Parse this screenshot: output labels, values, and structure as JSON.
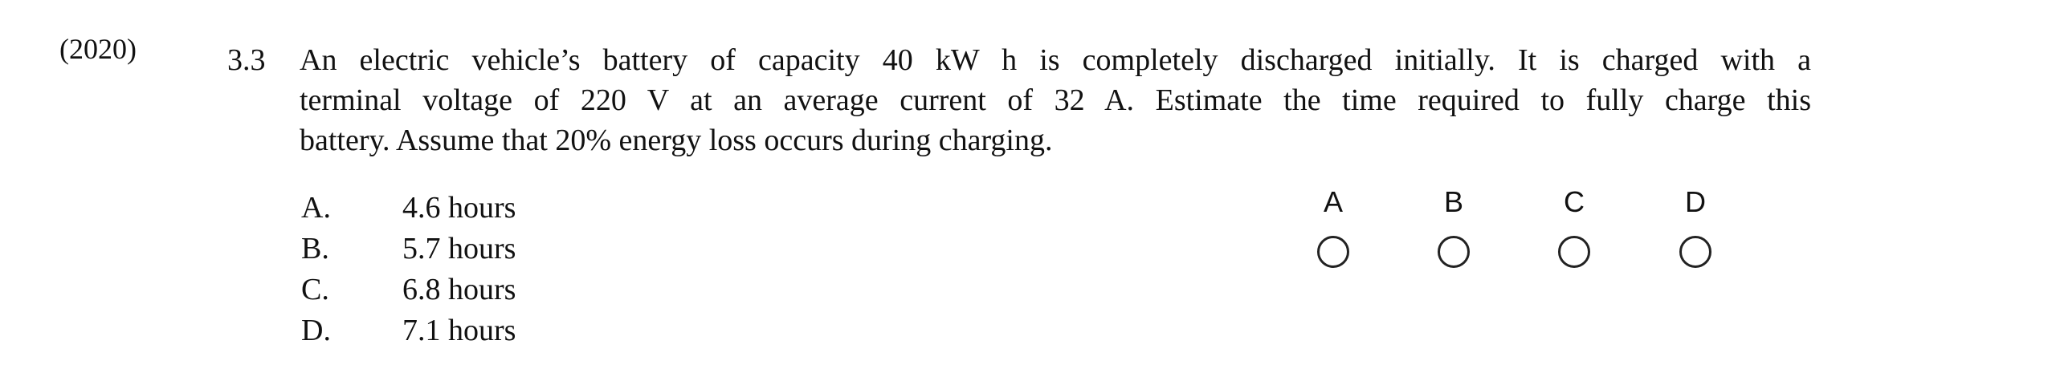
{
  "year": "(2020)",
  "question": {
    "number": "3.3",
    "lines": [
      "An electric vehicle’s battery of capacity 40 kW h is completely discharged initially.  It is charged with a",
      "terminal voltage of 220 V at an average current of 32 A.  Estimate the time required to fully charge this",
      "battery.  Assume that 20% energy loss occurs during charging."
    ]
  },
  "choices": [
    {
      "letter": "A.",
      "text": "4.6 hours"
    },
    {
      "letter": "B.",
      "text": "5.7 hours"
    },
    {
      "letter": "C.",
      "text": "6.8 hours"
    },
    {
      "letter": "D.",
      "text": "7.1 hours"
    }
  ],
  "answer_options": [
    "A",
    "B",
    "C",
    "D"
  ]
}
